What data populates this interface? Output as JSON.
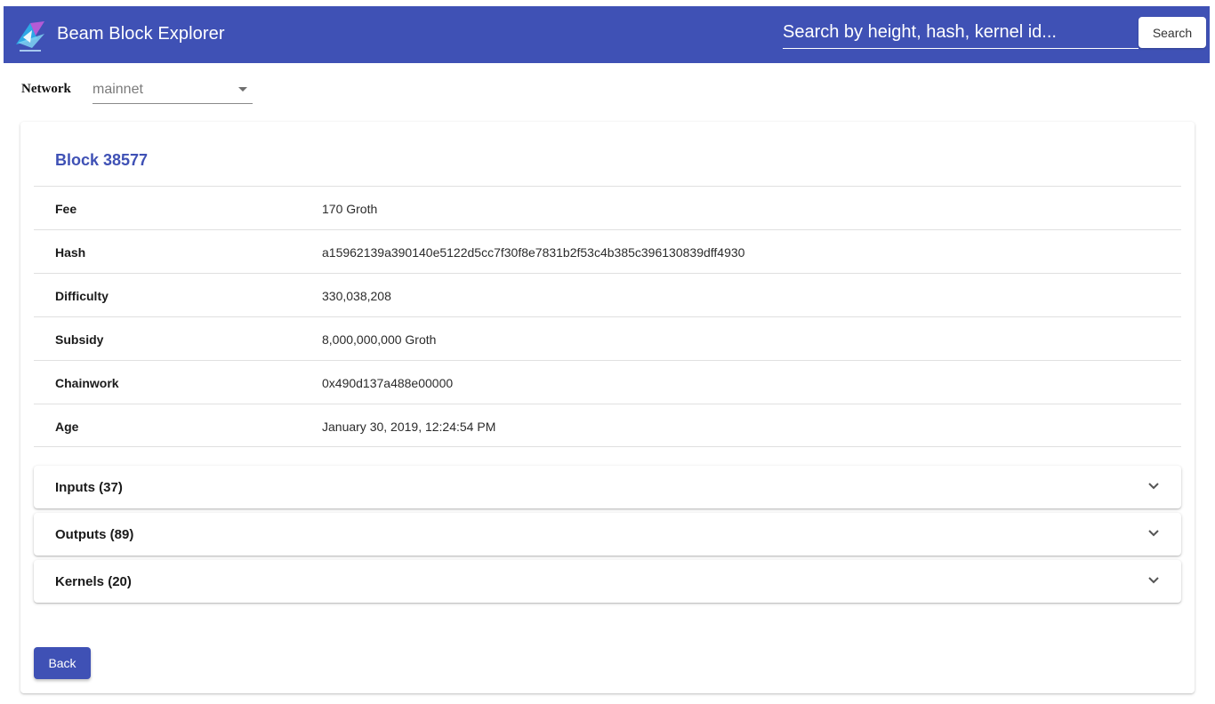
{
  "header": {
    "title": "Beam Block Explorer",
    "logo_icon": "beam-logo-icon",
    "search_placeholder": "Search by height, hash, kernel id...",
    "search_button_label": "Search",
    "background_color": "#3f51b5"
  },
  "network": {
    "label": "Network",
    "selected": "mainnet"
  },
  "block": {
    "title": "Block 38577",
    "details": [
      {
        "key": "Fee",
        "value": "170 Groth"
      },
      {
        "key": "Hash",
        "value": "a15962139a390140e5122d5cc7f30f8e7831b2f53c4b385c396130839dff4930"
      },
      {
        "key": "Difficulty",
        "value": "330,038,208"
      },
      {
        "key": "Subsidy",
        "value": "8,000,000,000 Groth"
      },
      {
        "key": "Chainwork",
        "value": "0x490d137a488e00000"
      },
      {
        "key": "Age",
        "value": "January 30, 2019, 12:24:54 PM"
      }
    ],
    "sections": [
      {
        "label": "Inputs (37)",
        "icon": "chevron-down-icon"
      },
      {
        "label": "Outputs (89)",
        "icon": "chevron-down-icon"
      },
      {
        "label": "Kernels (20)",
        "icon": "chevron-down-icon"
      }
    ],
    "back_label": "Back"
  }
}
